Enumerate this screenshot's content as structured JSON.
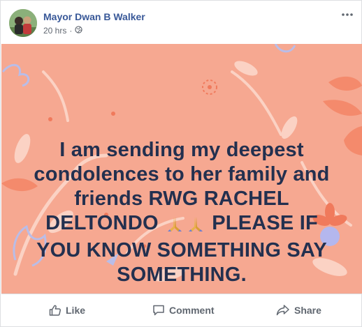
{
  "post": {
    "author": "Mayor Dwan B Walker",
    "time": "20 hrs",
    "separator": "·",
    "privacy_icon": "globe-icon",
    "more_icon": "more-dots-icon",
    "background_color": "#f6a891",
    "text_color": "#23304f",
    "text_lines": [
      "I am sending my deepest",
      "condolences to her family and",
      "friends RWG RACHEL",
      "DELTONDO",
      "PLEASE IF",
      "YOU KNOW SOMETHING SAY",
      "SOMETHING."
    ],
    "emoji_icon": "praying-hands-icon"
  },
  "actions": {
    "like": "Like",
    "comment": "Comment",
    "share": "Share"
  },
  "colors": {
    "author_link": "#385898",
    "meta_text": "#606770",
    "action_text": "#606770"
  }
}
